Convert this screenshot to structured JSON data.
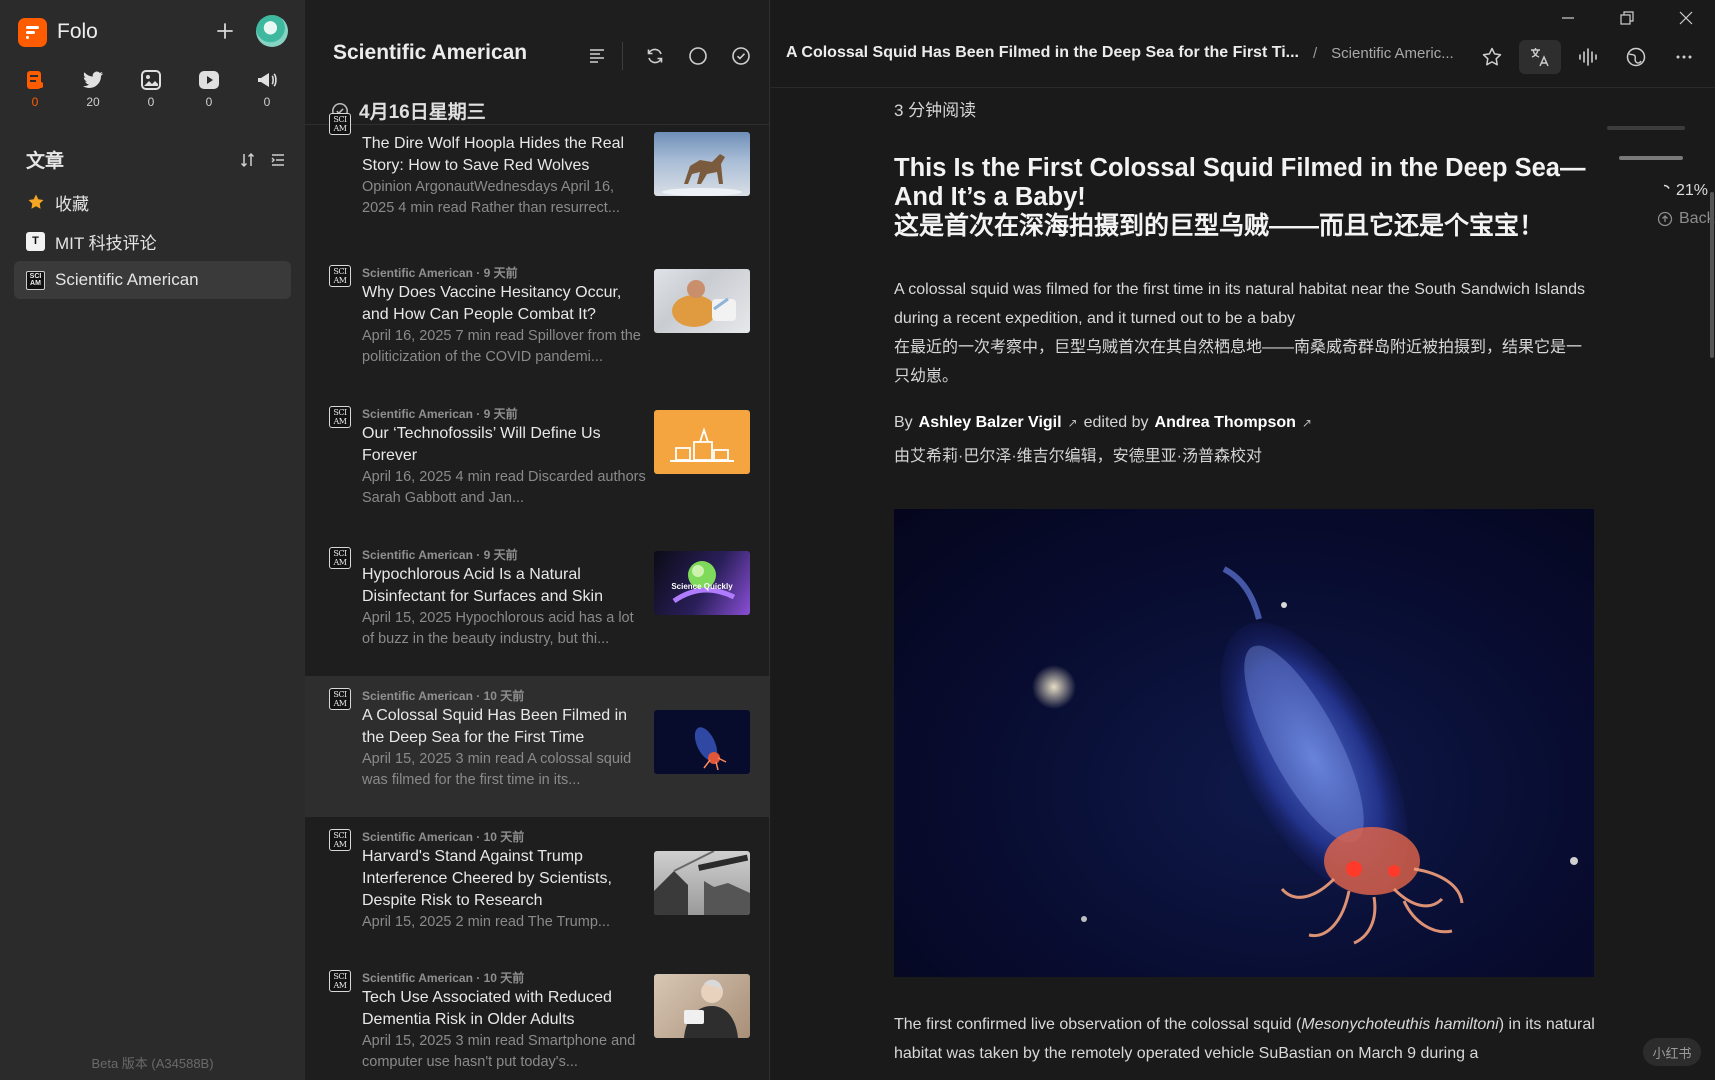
{
  "app": {
    "name": "Folo",
    "version": "Beta 版本 (A34588B)"
  },
  "views": [
    {
      "icon": "article-view-icon",
      "count": "0",
      "active": true
    },
    {
      "icon": "social-bird-icon",
      "count": "20"
    },
    {
      "icon": "pictures-icon",
      "count": "0"
    },
    {
      "icon": "video-play-icon",
      "count": "0"
    },
    {
      "icon": "notification-megaphone-icon",
      "count": "0"
    }
  ],
  "sidebar": {
    "section_title": "文章",
    "feeds": [
      {
        "label": "收藏",
        "icon": "star-icon"
      },
      {
        "label": "MIT 科技评论",
        "icon": "mit-logo-icon"
      },
      {
        "label": "Scientific American",
        "icon": "sciam-logo-icon"
      }
    ]
  },
  "list": {
    "title": "Scientific American",
    "date": "4月16日星期三",
    "icon_text": "SCI AM",
    "entries": [
      {
        "meta": "",
        "title": "The Dire Wolf Hoopla Hides the Real Story: How to Save Red Wolves",
        "desc": "Opinion ArgonautWednesdays April 16, 2025 4 min read Rather than resurrect..."
      },
      {
        "meta": "Scientific American · 9 天前",
        "title": "Why Does Vaccine Hesitancy Occur, and How Can People Combat It?",
        "desc": "April 16, 2025 7 min read Spillover from the politicization of the COVID pandemi..."
      },
      {
        "meta": "Scientific American · 9 天前",
        "title": "Our ‘Technofossils’ Will Define Us Forever",
        "desc": "April 16, 2025 4 min read Discarded authors Sarah Gabbott and Jan..."
      },
      {
        "meta": "Scientific American · 9 天前",
        "title": "Hypochlorous Acid Is a Natural Disinfectant for Surfaces and Skin",
        "desc": "April 15, 2025 Hypochlorous acid has a lot of buzz in the beauty industry, but thi..."
      },
      {
        "meta": "Scientific American · 10 天前",
        "title": "A Colossal Squid Has Been Filmed in the Deep Sea for the First Time",
        "desc": "April 15, 2025 3 min read A colossal squid was filmed for the first time in its..."
      },
      {
        "meta": "Scientific American · 10 天前",
        "title": "Harvard's Stand Against Trump Interference Cheered by Scientists, Despite Risk to Research",
        "desc": "April 15, 2025 2 min read The Trump..."
      },
      {
        "meta": "Scientific American · 10 天前",
        "title": "Tech Use Associated with Reduced Dementia Risk in Older Adults",
        "desc": "April 15, 2025 3 min read Smartphone and computer use hasn't put today's..."
      }
    ],
    "thumb_texts": {
      "podcast": "Science Quickly"
    }
  },
  "reader": {
    "crumb_title": "A Colossal Squid Has Been Filmed in the Deep Sea for the First Ti...",
    "crumb_sep": "/",
    "crumb_feed": "Scientific Americ...",
    "read_time": "3 分钟阅读",
    "title_en": "This Is the First Colossal Squid Filmed in the Deep Sea—And It’s a Baby!",
    "title_zh": "这是首次在深海拍摄到的巨型乌贼——而且它还是个宝宝！",
    "summary_en": "A colossal squid was filmed for the first time in its natural habitat near the South Sandwich Islands during a recent expedition, and it turned out to be a baby",
    "summary_zh": "在最近的一次考察中，巨型乌贼首次在其自然栖息地——南桑威奇群岛附近被拍摄到，结果它是一只幼崽。",
    "by": "By",
    "author": "Ashley Balzer Vigil",
    "edited_by": "edited by",
    "editor": "Andrea Thompson",
    "byline_zh": "由艾希莉·巴尔泽·维吉尔编辑，安德里亚·汤普森校对",
    "body_start": "The first confirmed live observation of the colossal squid (",
    "body_species": "Mesonychoteuthis hamiltoni",
    "body_end": ") in its natural habitat was taken by the remotely operated vehicle SuBastian on March 9 during a",
    "progress": "21%",
    "back_to_top": "Back To Top",
    "watermark": "小红书"
  },
  "colors": {
    "accent": "#ff5c00",
    "sidebar": "#2b2b2b",
    "list": "#1e1e1e",
    "reader": "#1a1a1a"
  }
}
